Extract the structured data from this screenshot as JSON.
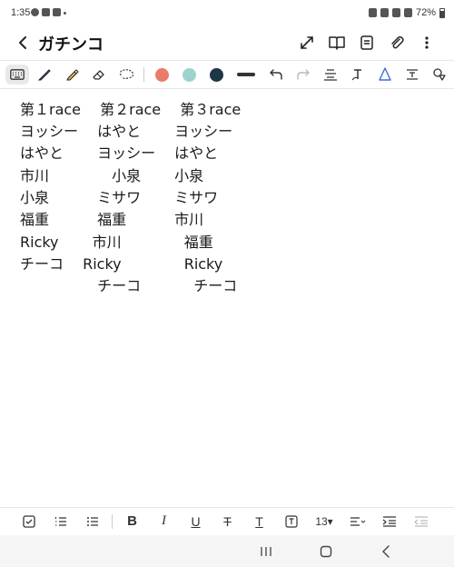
{
  "status": {
    "time": "1:35",
    "battery": "72%"
  },
  "app": {
    "title": "ガチンコ"
  },
  "pen_toolbar": {
    "colors": [
      "#ec7a6a",
      "#9ed3cd",
      "#1e3747"
    ]
  },
  "note": {
    "lines": [
      "第１race　 第２race　 第３race",
      "ヨッシー　 はやと　　 ヨッシー",
      "はやと　　 ヨッシー　 はやと",
      "市川　　　　 小泉　　 小泉",
      "小泉　　　 ミサワ　　 ミサワ",
      "福重　　　 福重　　　 市川",
      "Ricky　　 市川　　　　 福重",
      "チーコ　 Ricky　　　　 Ricky",
      "　　　　　 チーコ　　　  チーコ"
    ]
  },
  "format_bar": {
    "bold": "B",
    "italic": "I",
    "underline": "U",
    "strike": "T",
    "text": "T",
    "font_size": "13▾"
  }
}
